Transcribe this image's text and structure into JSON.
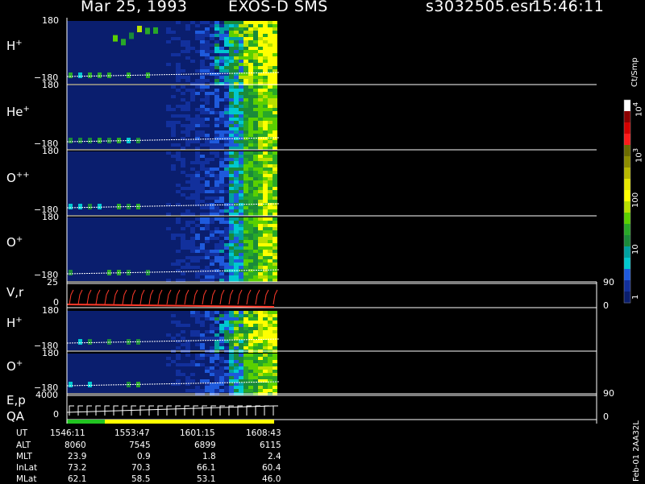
{
  "header": {
    "date": "Mar 25, 1993",
    "instrument": "EXOS-D SMS",
    "file": "s3032505.esr",
    "time": "15:46:11"
  },
  "panels": [
    {
      "id": "h1",
      "label": "H",
      "charge": "+",
      "top_tick": "180",
      "bottom_tick": "−180"
    },
    {
      "id": "he",
      "label": "He",
      "charge": "+",
      "top_tick": "180",
      "bottom_tick": "−180"
    },
    {
      "id": "opp",
      "label": "O",
      "charge": "++",
      "top_tick": "180",
      "bottom_tick": "−180"
    },
    {
      "id": "o1",
      "label": "O",
      "charge": "+",
      "top_tick": "180",
      "bottom_tick": "−180"
    },
    {
      "id": "vr",
      "label": "V,r",
      "top_tick": "25",
      "bottom_tick": "0",
      "right_top": "90",
      "right_bottom": "0"
    },
    {
      "id": "h2",
      "label": "H",
      "charge": "+",
      "top_tick": "180",
      "bottom_tick": "−180"
    },
    {
      "id": "o2",
      "label": "O",
      "charge": "+",
      "top_tick": "180",
      "bottom_tick": "−180"
    },
    {
      "id": "ep",
      "label": "E,p",
      "label2": "QA",
      "top_tick": "4000",
      "bottom_tick": "0",
      "right_top": "90",
      "right_bottom": "0"
    }
  ],
  "colorbar": {
    "unit": "Ct/Smp",
    "labels": [
      {
        "text": "10",
        "sup": "4"
      },
      {
        "text": "10",
        "sup": "3"
      },
      {
        "text": "100",
        "sup": ""
      },
      {
        "text": "10",
        "sup": ""
      },
      {
        "text": "1",
        "sup": ""
      }
    ],
    "colors": [
      "#ffffff",
      "#8b0000",
      "#d40000",
      "#ff1a1a",
      "#6b6b00",
      "#8c8c00",
      "#b8b800",
      "#e6e600",
      "#ffff00",
      "#b8e000",
      "#5ad000",
      "#28a828",
      "#1a8a3a",
      "#00a0a0",
      "#00c8d0",
      "#1e5adc",
      "#12309c",
      "#0a1e6e"
    ]
  },
  "time_table": {
    "rows": [
      {
        "name": "UT",
        "values": [
          "1546:11",
          "1553:47",
          "1601:15",
          "1608:43"
        ]
      },
      {
        "name": "ALT",
        "values": [
          "8060",
          "7545",
          "6899",
          "6115"
        ]
      },
      {
        "name": "MLT",
        "values": [
          "23.9",
          "0.9",
          "1.8",
          "2.4"
        ]
      },
      {
        "name": "InLat",
        "values": [
          "73.2",
          "70.3",
          "66.1",
          "60.4"
        ]
      },
      {
        "name": "MLat",
        "values": [
          "62.1",
          "58.5",
          "53.1",
          "46.0"
        ]
      }
    ]
  },
  "footer_id": "Feb-01 2AA32L",
  "chart_data": {
    "type": "heatmap",
    "title": "Mar 25, 1993   EXOS-D SMS",
    "x_ticks": [
      "1546:11",
      "1553:47",
      "1601:15",
      "1608:43"
    ],
    "series": [
      {
        "name": "H+",
        "ylim": [
          -180,
          180
        ]
      },
      {
        "name": "He+",
        "ylim": [
          -180,
          180
        ]
      },
      {
        "name": "O++",
        "ylim": [
          -180,
          180
        ]
      },
      {
        "name": "O+",
        "ylim": [
          -180,
          180
        ]
      },
      {
        "name": "V,r",
        "ylim": [
          0,
          25
        ],
        "right_ylim": [
          0,
          90
        ]
      },
      {
        "name": "H+",
        "ylim": [
          -180,
          180
        ]
      },
      {
        "name": "O+",
        "ylim": [
          -180,
          180
        ]
      },
      {
        "name": "E,p",
        "ylim": [
          0,
          4000
        ],
        "right_ylim": [
          0,
          90
        ]
      }
    ],
    "colorbar_unit": "Ct/Smp",
    "colorbar_ticks": [
      "1",
      "10",
      "100",
      "10^3",
      "10^4"
    ]
  }
}
